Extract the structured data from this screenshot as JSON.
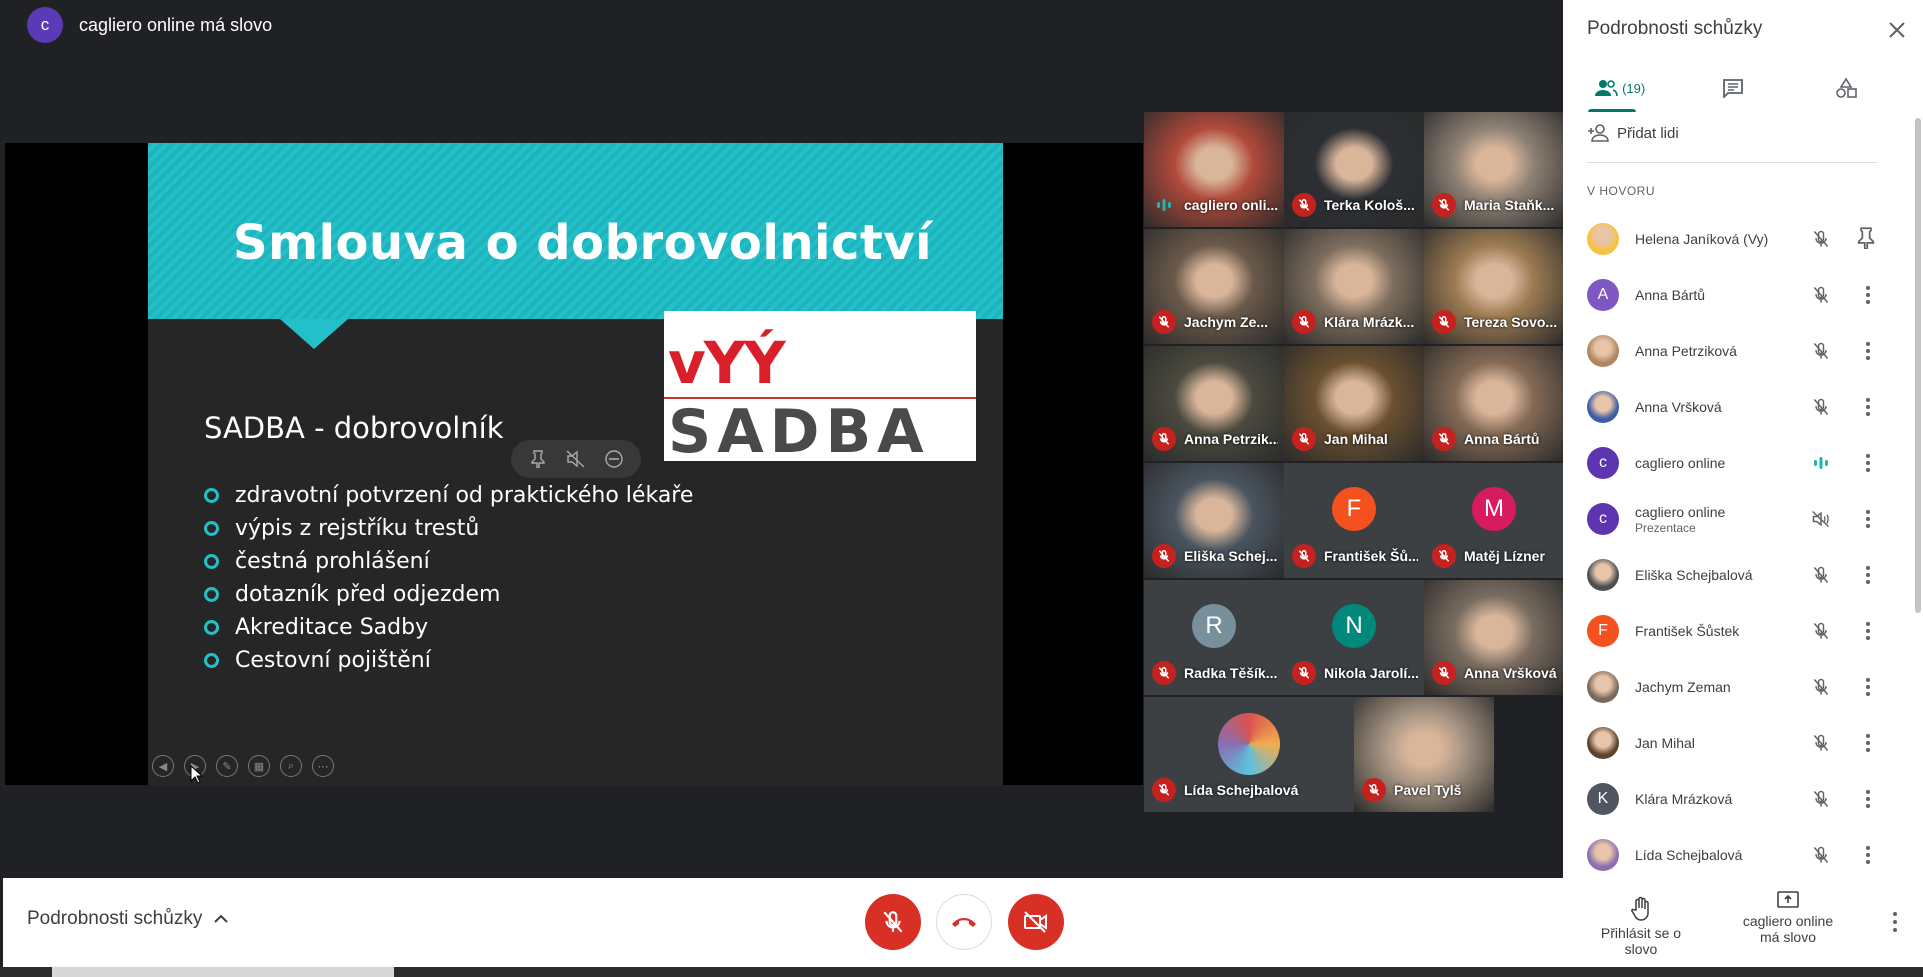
{
  "meeting": {
    "avatar_letter": "c",
    "title": "cagliero online má slovo"
  },
  "slide": {
    "title": "Smlouva o dobrovolnictví",
    "logo_top": "vYÝ",
    "logo_word": "SADBA",
    "subtitle": "SADBA - dobrovolník",
    "bullets": [
      "zdravotní potvrzení od praktického lékaře",
      "výpis z rejstříku trestů",
      "čestná prohlášení",
      "dotazník před odjezdem",
      "Akreditace Sadby",
      "Cestovní pojištění"
    ],
    "tools": [
      "pin-icon",
      "mute-icon",
      "remove-icon"
    ]
  },
  "tiles": [
    {
      "name": "cagliero onli...",
      "mic": "speaking",
      "photo": "#b04a3b"
    },
    {
      "name": "Terka Kološ...",
      "mic": "off",
      "photo": "#2c2f33"
    },
    {
      "name": "Maria Staňk...",
      "mic": "off",
      "photo": "#8f8275"
    },
    {
      "name": "Jachym Ze...",
      "mic": "off",
      "photo": "#6b5a4a"
    },
    {
      "name": "Klára Mrázk...",
      "mic": "off",
      "photo": "#7d6e5e"
    },
    {
      "name": "Tereza Sovo...",
      "mic": "off",
      "photo": "#9c7b52"
    },
    {
      "name": "Anna Petrzik...",
      "mic": "off",
      "photo": "#4b4a3f"
    },
    {
      "name": "Jan Mihal",
      "mic": "off",
      "photo": "#6a5030"
    },
    {
      "name": "Anna Bártů",
      "mic": "off",
      "photo": "#846a55"
    },
    {
      "name": "Eliška Schej...",
      "mic": "off",
      "photo": "#4a5560"
    },
    {
      "name": "František Šů...",
      "mic": "off",
      "letter": "F",
      "letter_color": "#f4511e"
    },
    {
      "name": "Matěj Lízner",
      "mic": "off",
      "letter": "M",
      "letter_color": "#d81b60"
    },
    {
      "name": "Radka Těšík...",
      "mic": "off",
      "letter": "R",
      "letter_color": "#78909c"
    },
    {
      "name": "Nikola Jarolí...",
      "mic": "off",
      "letter": "N",
      "letter_color": "#00897b"
    },
    {
      "name": "Anna Vršková",
      "mic": "off",
      "photo": "#7a6d60"
    },
    {
      "name": "Lída Schejbalová",
      "mic": "off",
      "round_photo": "#8a6fb0"
    },
    {
      "name": "Pavel Tylš",
      "mic": "off",
      "photo": "#a89684"
    }
  ],
  "bottom": {
    "details_label": "Podrobnosti schůzky",
    "raise_hand": "Přihlásit se o slovo",
    "present_line1": "cagliero online",
    "present_line2": "má slovo"
  },
  "panel": {
    "title": "Podrobnosti schůzky",
    "people_count": "(19)",
    "add_people": "Přidat lidi",
    "section_label": "V HOVORU",
    "people": [
      {
        "name": "Helena Janíková (Vy)",
        "avatar": "#f6c341",
        "letter": "",
        "mic": "muted",
        "action": "pin"
      },
      {
        "name": "Anna Bártů",
        "avatar": "#7e57c2",
        "letter": "A",
        "mic": "muted",
        "action": "more"
      },
      {
        "name": "Anna Petrziková",
        "avatar": "#b08560",
        "letter": "",
        "mic": "muted",
        "action": "more"
      },
      {
        "name": "Anna Vršková",
        "avatar": "#3d5ca8",
        "letter": "",
        "mic": "muted",
        "action": "more"
      },
      {
        "name": "cagliero online",
        "avatar": "#5e35b1",
        "letter": "c",
        "mic": "speaking",
        "action": "more"
      },
      {
        "name": "cagliero online",
        "sub": "Prezentace",
        "avatar": "#5e35b1",
        "letter": "c",
        "mic": "volume-off",
        "action": "more"
      },
      {
        "name": "Eliška Schejbalová",
        "avatar": "#4b4e52",
        "letter": "",
        "mic": "muted",
        "action": "more"
      },
      {
        "name": "František Šůstek",
        "avatar": "#f4511e",
        "letter": "F",
        "mic": "muted",
        "action": "more"
      },
      {
        "name": "Jachym Zeman",
        "avatar": "#7a6a5c",
        "letter": "",
        "mic": "muted",
        "action": "more"
      },
      {
        "name": "Jan Mihal",
        "avatar": "#5a4330",
        "letter": "",
        "mic": "muted",
        "action": "more"
      },
      {
        "name": "Klára Mrázková",
        "avatar": "#4e5660",
        "letter": "K",
        "mic": "muted",
        "action": "more"
      },
      {
        "name": "Lída Schejbalová",
        "avatar": "#8a6fb0",
        "letter": "",
        "mic": "muted",
        "action": "more"
      }
    ]
  },
  "colors": {
    "accent": "#00796b",
    "danger": "#d93025",
    "slide_teal": "#22c0c9"
  }
}
